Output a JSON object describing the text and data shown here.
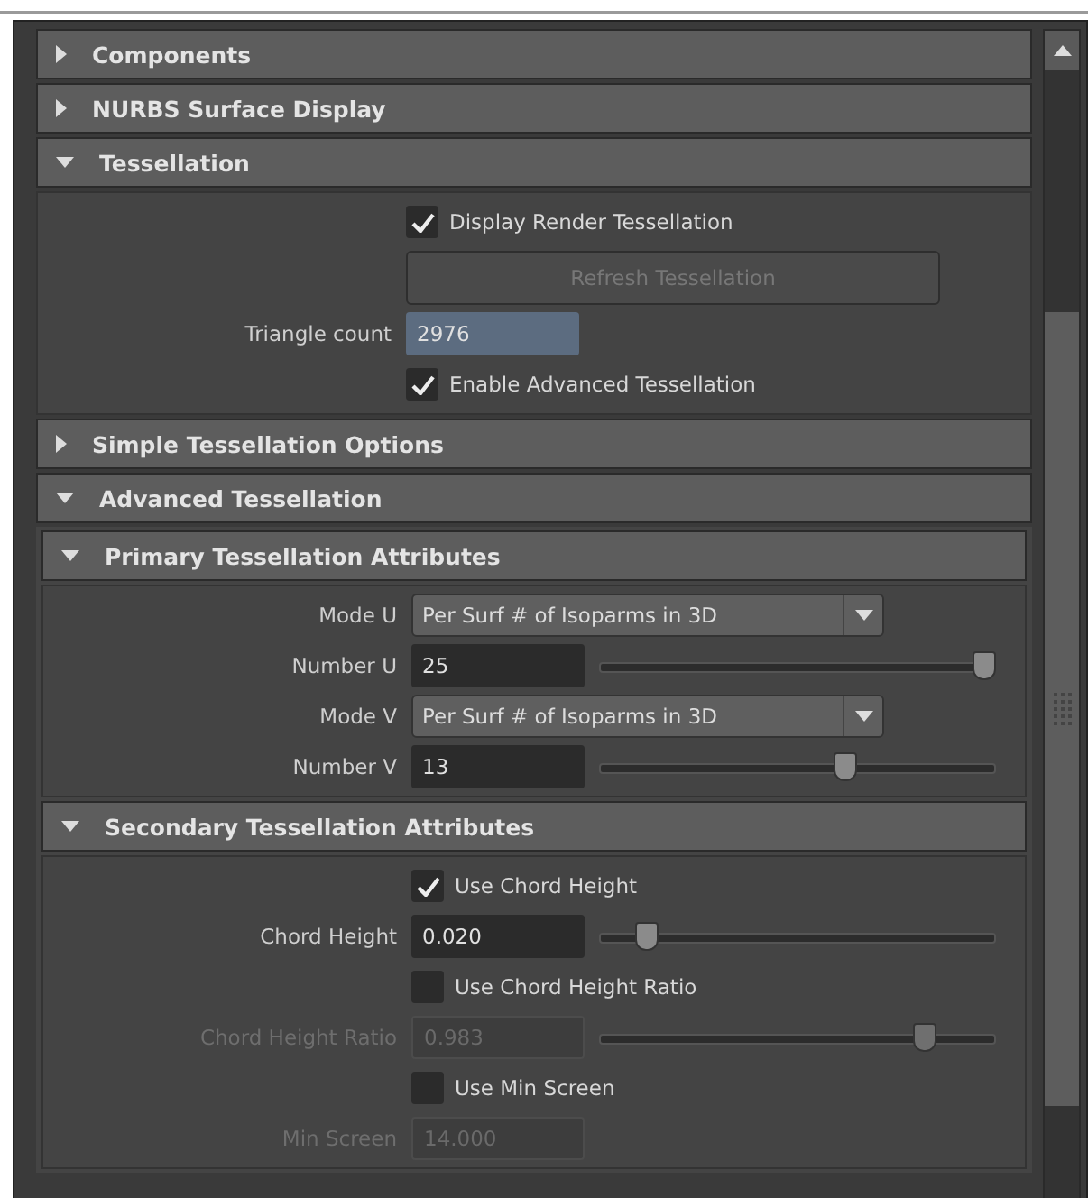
{
  "sections": [
    {
      "title": "Components",
      "expanded": false
    },
    {
      "title": "NURBS Surface Display",
      "expanded": false
    },
    {
      "title": "Tessellation",
      "expanded": true,
      "rows": [
        {
          "kind": "checkbox",
          "label": "Display Render Tessellation",
          "checked": true
        },
        {
          "kind": "button",
          "label": "Refresh Tessellation",
          "disabled": true
        },
        {
          "kind": "readout",
          "label": "Triangle count",
          "value": "2976"
        },
        {
          "kind": "checkbox",
          "label": "Enable Advanced Tessellation",
          "checked": true
        }
      ]
    },
    {
      "title": "Simple Tessellation Options",
      "expanded": false
    },
    {
      "title": "Advanced Tessellation",
      "expanded": true,
      "children": [
        {
          "title": "Primary Tessellation Attributes",
          "expanded": true,
          "rows": [
            {
              "kind": "dropdown",
              "label": "Mode U",
              "value": "Per Surf # of Isoparms in 3D"
            },
            {
              "kind": "slider",
              "label": "Number U",
              "value": "25",
              "level": 0.97,
              "disabled": false
            },
            {
              "kind": "dropdown",
              "label": "Mode V",
              "value": "Per Surf # of Isoparms in 3D"
            },
            {
              "kind": "slider",
              "label": "Number V",
              "value": "13",
              "level": 0.62,
              "disabled": false
            }
          ]
        },
        {
          "title": "Secondary Tessellation Attributes",
          "expanded": true,
          "rows": [
            {
              "kind": "checkbox",
              "label": "Use Chord Height",
              "checked": true
            },
            {
              "kind": "slider",
              "label": "Chord Height",
              "value": "0.020",
              "level": 0.12,
              "disabled": false
            },
            {
              "kind": "checkbox",
              "label": "Use Chord Height Ratio",
              "checked": false
            },
            {
              "kind": "slider",
              "label": "Chord Height Ratio",
              "value": "0.983",
              "level": 0.82,
              "disabled": true
            },
            {
              "kind": "checkbox",
              "label": "Use Min Screen",
              "checked": false
            },
            {
              "kind": "field",
              "label": "Min Screen",
              "value": "14.000",
              "disabled": true
            }
          ]
        }
      ]
    }
  ]
}
